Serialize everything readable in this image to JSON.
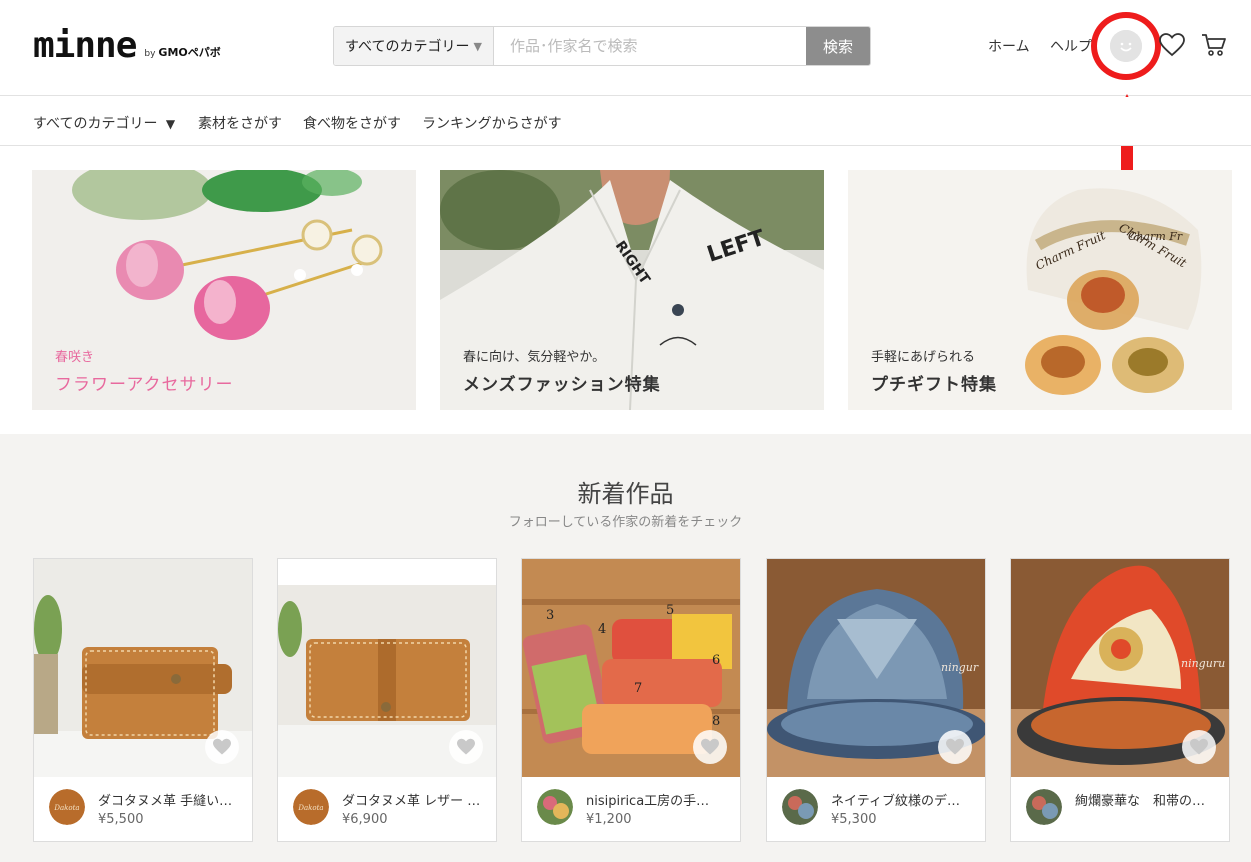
{
  "header": {
    "logo": "minne",
    "logo_by": "by",
    "logo_company": "GMOペパボ",
    "search": {
      "category": "すべてのカテゴリー",
      "placeholder": "作品･作家名で検索",
      "button": "検索"
    },
    "nav": {
      "home": "ホーム",
      "help": "ヘルプ"
    },
    "icons": [
      "avatar-icon",
      "heart-icon",
      "cart-icon"
    ]
  },
  "catbar": {
    "items": [
      "すべてのカテゴリー",
      "素材をさがす",
      "食べ物をさがす",
      "ランキングからさがす"
    ]
  },
  "banners": [
    {
      "sub": "春咲き",
      "title": "フラワーアクセサリー",
      "color": "#e8699e"
    },
    {
      "sub": "春に向け、気分軽やか。",
      "title": "メンズファッション特集",
      "color": "#333333",
      "image_text": [
        "RIGHT",
        "LEFT"
      ]
    },
    {
      "sub": "手軽にあげられる",
      "title": "プチギフト特集",
      "color": "#333333",
      "image_text": [
        "Charm Fruit",
        "Charm Fruit",
        "Charm Fr"
      ]
    }
  ],
  "new_arrivals": {
    "title": "新着作品",
    "subtitle": "フォローしている作家の新着をチェック",
    "items": [
      {
        "name": "ダコタヌメ革 手縫い…",
        "price": "¥5,500"
      },
      {
        "name": "ダコタヌメ革 レザー …",
        "price": "¥6,900"
      },
      {
        "name": "nisipirica工房の手…",
        "price": "¥1,200",
        "image_text": [
          "3",
          "4",
          "5",
          "6",
          "7",
          "8"
        ]
      },
      {
        "name": "ネイティブ紋様のデ…",
        "price": "¥5,300",
        "image_text": "ningur"
      },
      {
        "name": "絢爛豪華な　和帯の…",
        "price": "",
        "image_text": "ninguru"
      }
    ]
  },
  "colors": {
    "accent_red": "#ee1c1c",
    "search_button": "#8d8d8d",
    "pink": "#e8699e"
  }
}
